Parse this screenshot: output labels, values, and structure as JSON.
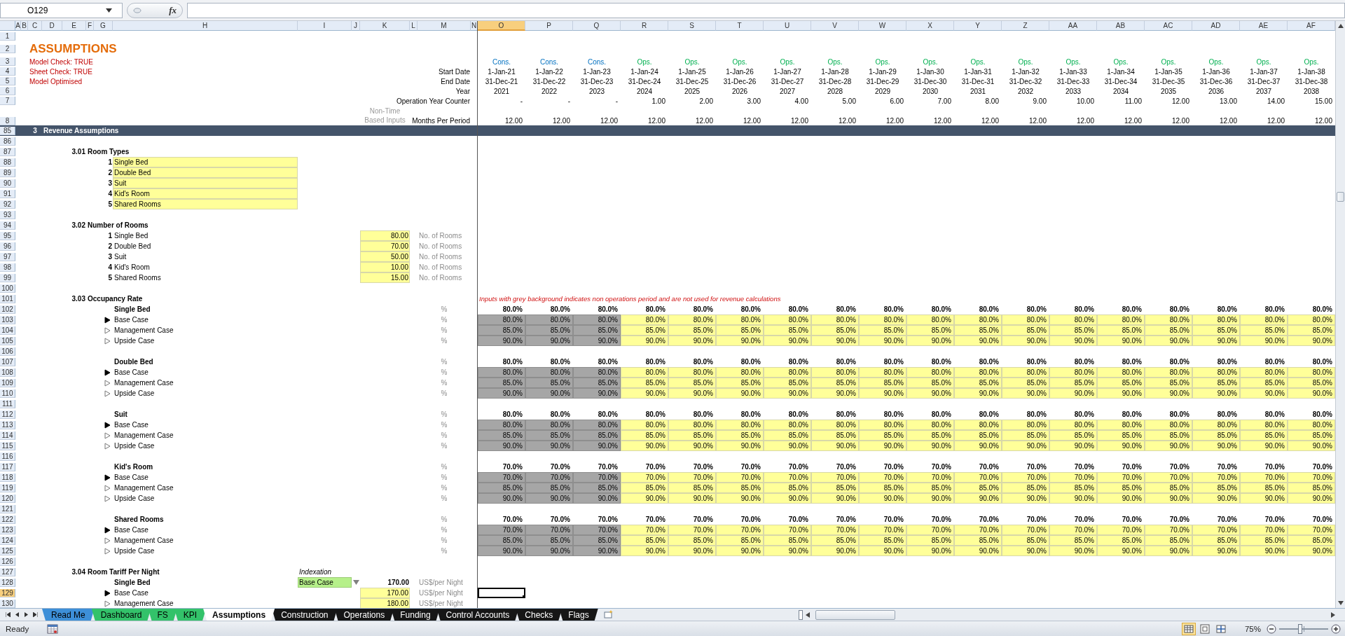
{
  "formula_bar": {
    "name_box": "O129",
    "function_label": "fx"
  },
  "columns": [
    {
      "letter": "A",
      "selected": false
    },
    {
      "letter": "B",
      "selected": false
    },
    {
      "letter": "C",
      "selected": false
    },
    {
      "letter": "D",
      "selected": false
    },
    {
      "letter": "E",
      "selected": false
    },
    {
      "letter": "F",
      "selected": false
    },
    {
      "letter": "G",
      "selected": false
    },
    {
      "letter": "H",
      "selected": false
    },
    {
      "letter": "I",
      "selected": false
    },
    {
      "letter": "J",
      "selected": false
    },
    {
      "letter": "K",
      "selected": false
    },
    {
      "letter": "L",
      "selected": false
    },
    {
      "letter": "M",
      "selected": false
    },
    {
      "letter": "N",
      "selected": false
    },
    {
      "letter": "O",
      "selected": true,
      "kind": "construction"
    },
    {
      "letter": "P",
      "selected": false,
      "kind": "construction"
    },
    {
      "letter": "Q",
      "selected": false,
      "kind": "construction"
    },
    {
      "letter": "R",
      "selected": false,
      "kind": "operations"
    },
    {
      "letter": "S",
      "selected": false,
      "kind": "operations"
    },
    {
      "letter": "T",
      "selected": false,
      "kind": "operations"
    },
    {
      "letter": "U",
      "selected": false,
      "kind": "operations"
    },
    {
      "letter": "V",
      "selected": false,
      "kind": "operations"
    },
    {
      "letter": "W",
      "selected": false,
      "kind": "operations"
    },
    {
      "letter": "X",
      "selected": false,
      "kind": "operations"
    },
    {
      "letter": "Y",
      "selected": false,
      "kind": "operations"
    },
    {
      "letter": "Z",
      "selected": false,
      "kind": "operations"
    },
    {
      "letter": "AA",
      "selected": false,
      "kind": "operations"
    },
    {
      "letter": "AB",
      "selected": false,
      "kind": "operations"
    },
    {
      "letter": "AC",
      "selected": false,
      "kind": "operations"
    },
    {
      "letter": "AD",
      "selected": false,
      "kind": "operations"
    },
    {
      "letter": "AE",
      "selected": false,
      "kind": "operations"
    },
    {
      "letter": "AF",
      "selected": false,
      "kind": "operations"
    }
  ],
  "rows": [
    {
      "number": "1",
      "selected": false,
      "kind": "plain"
    },
    {
      "number": "2",
      "selected": false,
      "kind": "title",
      "cells": {
        "C": {
          "kind": "title",
          "text": "ASSUMPTIONS"
        }
      }
    },
    {
      "number": "3",
      "selected": false,
      "kind": "periods",
      "cells": {
        "C": {
          "kind": "check",
          "text": "Model Check: TRUE"
        }
      },
      "values": [
        "Cons.",
        "Cons.",
        "Cons.",
        "Ops.",
        "Ops.",
        "Ops.",
        "Ops.",
        "Ops.",
        "Ops.",
        "Ops.",
        "Ops.",
        "Ops.",
        "Ops.",
        "Ops.",
        "Ops.",
        "Ops.",
        "Ops.",
        "Ops."
      ]
    },
    {
      "number": "4",
      "selected": false,
      "kind": "dates",
      "cells": {
        "C": {
          "kind": "check",
          "text": "Sheet Check: TRUE"
        },
        "M": {
          "kind": "label",
          "text": "Start Date"
        }
      },
      "values": [
        "1-Jan-21",
        "1-Jan-22",
        "1-Jan-23",
        "1-Jan-24",
        "1-Jan-25",
        "1-Jan-26",
        "1-Jan-27",
        "1-Jan-28",
        "1-Jan-29",
        "1-Jan-30",
        "1-Jan-31",
        "1-Jan-32",
        "1-Jan-33",
        "1-Jan-34",
        "1-Jan-35",
        "1-Jan-36",
        "1-Jan-37",
        "1-Jan-38"
      ]
    },
    {
      "number": "5",
      "selected": false,
      "kind": "dates",
      "cells": {
        "C": {
          "kind": "check",
          "text": "Model Optimised"
        },
        "M": {
          "kind": "label",
          "text": "End Date"
        }
      },
      "values": [
        "31-Dec-21",
        "31-Dec-22",
        "31-Dec-23",
        "31-Dec-24",
        "31-Dec-25",
        "31-Dec-26",
        "31-Dec-27",
        "31-Dec-28",
        "31-Dec-29",
        "31-Dec-30",
        "31-Dec-31",
        "31-Dec-32",
        "31-Dec-33",
        "31-Dec-34",
        "31-Dec-35",
        "31-Dec-36",
        "31-Dec-37",
        "31-Dec-38"
      ]
    },
    {
      "number": "6",
      "selected": false,
      "kind": "dates",
      "cells": {
        "M": {
          "kind": "label",
          "text": "Year"
        }
      },
      "values": [
        "2021",
        "2022",
        "2023",
        "2024",
        "2025",
        "2026",
        "2027",
        "2028",
        "2029",
        "2030",
        "2031",
        "2032",
        "2033",
        "2034",
        "2035",
        "2036",
        "2037",
        "2038"
      ]
    },
    {
      "number": "7",
      "selected": false,
      "kind": "counter",
      "cells": {
        "M": {
          "kind": "label",
          "text": "Operation Year Counter"
        }
      },
      "values": [
        "-",
        "-",
        "-",
        "1.00",
        "2.00",
        "3.00",
        "4.00",
        "5.00",
        "6.00",
        "7.00",
        "8.00",
        "9.00",
        "10.00",
        "11.00",
        "12.00",
        "13.00",
        "14.00",
        "15.00"
      ]
    },
    {
      "number": "8",
      "selected": false,
      "kind": "months",
      "cells": {
        "K": {
          "kind": "note",
          "text": "Non-Time Based Inputs"
        },
        "M": {
          "kind": "label",
          "text": "Months Per Period"
        }
      },
      "values": [
        "12.00",
        "12.00",
        "12.00",
        "12.00",
        "12.00",
        "12.00",
        "12.00",
        "12.00",
        "12.00",
        "12.00",
        "12.00",
        "12.00",
        "12.00",
        "12.00",
        "12.00",
        "12.00",
        "12.00",
        "12.00"
      ]
    },
    {
      "number": "85",
      "selected": false,
      "kind": "band",
      "cells": {
        "C": {
          "kind": "section-number",
          "text": "3"
        },
        "D": {
          "kind": "section",
          "text": "Revenue Assumptions"
        }
      }
    },
    {
      "number": "86",
      "selected": false,
      "kind": "plain"
    },
    {
      "number": "87",
      "selected": false,
      "kind": "plain",
      "cells": {
        "E": {
          "kind": "heading-number",
          "text": "3.01"
        },
        "F": {
          "kind": "heading",
          "text": "Room Types"
        }
      }
    },
    {
      "number": "88",
      "selected": false,
      "kind": "plain",
      "cells": {
        "G": {
          "kind": "item-number",
          "text": "1"
        },
        "H": {
          "kind": "input-text",
          "text": "Single Bed"
        }
      }
    },
    {
      "number": "89",
      "selected": false,
      "kind": "plain",
      "cells": {
        "G": {
          "kind": "item-number",
          "text": "2"
        },
        "H": {
          "kind": "input-text",
          "text": "Double Bed"
        }
      }
    },
    {
      "number": "90",
      "selected": false,
      "kind": "plain",
      "cells": {
        "G": {
          "kind": "item-number",
          "text": "3"
        },
        "H": {
          "kind": "input-text",
          "text": "Suit"
        }
      }
    },
    {
      "number": "91",
      "selected": false,
      "kind": "plain",
      "cells": {
        "G": {
          "kind": "item-number",
          "text": "4"
        },
        "H": {
          "kind": "input-text",
          "text": "Kid's Room"
        }
      }
    },
    {
      "number": "92",
      "selected": false,
      "kind": "plain",
      "cells": {
        "G": {
          "kind": "item-number",
          "text": "5"
        },
        "H": {
          "kind": "input-text",
          "text": "Shared Rooms"
        }
      }
    },
    {
      "number": "93",
      "selected": false,
      "kind": "plain"
    },
    {
      "number": "94",
      "selected": false,
      "kind": "plain",
      "cells": {
        "E": {
          "kind": "heading-number",
          "text": "3.02"
        },
        "F": {
          "kind": "heading",
          "text": "Number of Rooms"
        }
      }
    },
    {
      "number": "95",
      "selected": false,
      "kind": "plain",
      "cells": {
        "G": {
          "kind": "item-number",
          "text": "1"
        },
        "H": {
          "kind": "item",
          "text": "Single Bed"
        },
        "K": {
          "kind": "input-number",
          "text": "80.00"
        },
        "M": {
          "kind": "unit",
          "text": "No. of Rooms"
        }
      }
    },
    {
      "number": "96",
      "selected": false,
      "kind": "plain",
      "cells": {
        "G": {
          "kind": "item-number",
          "text": "2"
        },
        "H": {
          "kind": "item",
          "text": "Double Bed"
        },
        "K": {
          "kind": "input-number",
          "text": "70.00"
        },
        "M": {
          "kind": "unit",
          "text": "No. of Rooms"
        }
      }
    },
    {
      "number": "97",
      "selected": false,
      "kind": "plain",
      "cells": {
        "G": {
          "kind": "item-number",
          "text": "3"
        },
        "H": {
          "kind": "item",
          "text": "Suit"
        },
        "K": {
          "kind": "input-number",
          "text": "50.00"
        },
        "M": {
          "kind": "unit",
          "text": "No. of Rooms"
        }
      }
    },
    {
      "number": "98",
      "selected": false,
      "kind": "plain",
      "cells": {
        "G": {
          "kind": "item-number",
          "text": "4"
        },
        "H": {
          "kind": "item",
          "text": "Kid's Room"
        },
        "K": {
          "kind": "input-number",
          "text": "10.00"
        },
        "M": {
          "kind": "unit",
          "text": "No. of Rooms"
        }
      }
    },
    {
      "number": "99",
      "selected": false,
      "kind": "plain",
      "cells": {
        "G": {
          "kind": "item-number",
          "text": "5"
        },
        "H": {
          "kind": "item",
          "text": "Shared Rooms"
        },
        "K": {
          "kind": "input-number",
          "text": "15.00"
        },
        "M": {
          "kind": "unit",
          "text": "No. of Rooms"
        }
      }
    },
    {
      "number": "100",
      "selected": false,
      "kind": "plain"
    },
    {
      "number": "101",
      "selected": false,
      "kind": "plain",
      "cells": {
        "E": {
          "kind": "heading-number",
          "text": "3.03"
        },
        "F": {
          "kind": "heading",
          "text": "Occupancy Rate"
        }
      },
      "note": "Inputs with grey background indicates non operations period and are not used for revenue calculations"
    },
    {
      "number": "102",
      "selected": false,
      "kind": "totals",
      "cells": {
        "H": {
          "kind": "subheading",
          "text": "Single Bed"
        },
        "M": {
          "kind": "unit-center",
          "text": "%"
        }
      },
      "values": [
        "80.0%",
        "80.0%",
        "80.0%",
        "80.0%",
        "80.0%",
        "80.0%",
        "80.0%",
        "80.0%",
        "80.0%",
        "80.0%",
        "80.0%",
        "80.0%",
        "80.0%",
        "80.0%",
        "80.0%",
        "80.0%",
        "80.0%",
        "80.0%"
      ]
    },
    {
      "number": "103",
      "selected": false,
      "kind": "inputs",
      "cells": {
        "H": {
          "kind": "scenario",
          "text": "Base Case",
          "on": true
        },
        "M": {
          "kind": "unit-center",
          "text": "%"
        }
      },
      "values": [
        "80.0%",
        "80.0%",
        "80.0%",
        "80.0%",
        "80.0%",
        "80.0%",
        "80.0%",
        "80.0%",
        "80.0%",
        "80.0%",
        "80.0%",
        "80.0%",
        "80.0%",
        "80.0%",
        "80.0%",
        "80.0%",
        "80.0%",
        "80.0%"
      ]
    },
    {
      "number": "104",
      "selected": false,
      "kind": "inputs",
      "cells": {
        "H": {
          "kind": "scenario",
          "text": "Management Case",
          "on": false
        },
        "M": {
          "kind": "unit-center",
          "text": "%"
        }
      },
      "values": [
        "85.0%",
        "85.0%",
        "85.0%",
        "85.0%",
        "85.0%",
        "85.0%",
        "85.0%",
        "85.0%",
        "85.0%",
        "85.0%",
        "85.0%",
        "85.0%",
        "85.0%",
        "85.0%",
        "85.0%",
        "85.0%",
        "85.0%",
        "85.0%"
      ]
    },
    {
      "number": "105",
      "selected": false,
      "kind": "inputs",
      "cells": {
        "H": {
          "kind": "scenario",
          "text": "Upside Case",
          "on": false
        },
        "M": {
          "kind": "unit-center",
          "text": "%"
        }
      },
      "values": [
        "90.0%",
        "90.0%",
        "90.0%",
        "90.0%",
        "90.0%",
        "90.0%",
        "90.0%",
        "90.0%",
        "90.0%",
        "90.0%",
        "90.0%",
        "90.0%",
        "90.0%",
        "90.0%",
        "90.0%",
        "90.0%",
        "90.0%",
        "90.0%"
      ]
    },
    {
      "number": "106",
      "selected": false,
      "kind": "plain"
    },
    {
      "number": "107",
      "selected": false,
      "kind": "totals",
      "cells": {
        "H": {
          "kind": "subheading",
          "text": "Double Bed"
        },
        "M": {
          "kind": "unit-center",
          "text": "%"
        }
      },
      "values": [
        "80.0%",
        "80.0%",
        "80.0%",
        "80.0%",
        "80.0%",
        "80.0%",
        "80.0%",
        "80.0%",
        "80.0%",
        "80.0%",
        "80.0%",
        "80.0%",
        "80.0%",
        "80.0%",
        "80.0%",
        "80.0%",
        "80.0%",
        "80.0%"
      ]
    },
    {
      "number": "108",
      "selected": false,
      "kind": "inputs",
      "cells": {
        "H": {
          "kind": "scenario",
          "text": "Base Case",
          "on": true
        },
        "M": {
          "kind": "unit-center",
          "text": "%"
        }
      },
      "values": [
        "80.0%",
        "80.0%",
        "80.0%",
        "80.0%",
        "80.0%",
        "80.0%",
        "80.0%",
        "80.0%",
        "80.0%",
        "80.0%",
        "80.0%",
        "80.0%",
        "80.0%",
        "80.0%",
        "80.0%",
        "80.0%",
        "80.0%",
        "80.0%"
      ]
    },
    {
      "number": "109",
      "selected": false,
      "kind": "inputs",
      "cells": {
        "H": {
          "kind": "scenario",
          "text": "Management Case",
          "on": false
        },
        "M": {
          "kind": "unit-center",
          "text": "%"
        }
      },
      "values": [
        "85.0%",
        "85.0%",
        "85.0%",
        "85.0%",
        "85.0%",
        "85.0%",
        "85.0%",
        "85.0%",
        "85.0%",
        "85.0%",
        "85.0%",
        "85.0%",
        "85.0%",
        "85.0%",
        "85.0%",
        "85.0%",
        "85.0%",
        "85.0%"
      ]
    },
    {
      "number": "110",
      "selected": false,
      "kind": "inputs",
      "cells": {
        "H": {
          "kind": "scenario",
          "text": "Upside Case",
          "on": false
        },
        "M": {
          "kind": "unit-center",
          "text": "%"
        }
      },
      "values": [
        "90.0%",
        "90.0%",
        "90.0%",
        "90.0%",
        "90.0%",
        "90.0%",
        "90.0%",
        "90.0%",
        "90.0%",
        "90.0%",
        "90.0%",
        "90.0%",
        "90.0%",
        "90.0%",
        "90.0%",
        "90.0%",
        "90.0%",
        "90.0%"
      ]
    },
    {
      "number": "111",
      "selected": false,
      "kind": "plain"
    },
    {
      "number": "112",
      "selected": false,
      "kind": "totals",
      "cells": {
        "H": {
          "kind": "subheading",
          "text": "Suit"
        },
        "M": {
          "kind": "unit-center",
          "text": "%"
        }
      },
      "values": [
        "80.0%",
        "80.0%",
        "80.0%",
        "80.0%",
        "80.0%",
        "80.0%",
        "80.0%",
        "80.0%",
        "80.0%",
        "80.0%",
        "80.0%",
        "80.0%",
        "80.0%",
        "80.0%",
        "80.0%",
        "80.0%",
        "80.0%",
        "80.0%"
      ]
    },
    {
      "number": "113",
      "selected": false,
      "kind": "inputs",
      "cells": {
        "H": {
          "kind": "scenario",
          "text": "Base Case",
          "on": true
        },
        "M": {
          "kind": "unit-center",
          "text": "%"
        }
      },
      "values": [
        "80.0%",
        "80.0%",
        "80.0%",
        "80.0%",
        "80.0%",
        "80.0%",
        "80.0%",
        "80.0%",
        "80.0%",
        "80.0%",
        "80.0%",
        "80.0%",
        "80.0%",
        "80.0%",
        "80.0%",
        "80.0%",
        "80.0%",
        "80.0%"
      ]
    },
    {
      "number": "114",
      "selected": false,
      "kind": "inputs",
      "cells": {
        "H": {
          "kind": "scenario",
          "text": "Management Case",
          "on": false
        },
        "M": {
          "kind": "unit-center",
          "text": "%"
        }
      },
      "values": [
        "85.0%",
        "85.0%",
        "85.0%",
        "85.0%",
        "85.0%",
        "85.0%",
        "85.0%",
        "85.0%",
        "85.0%",
        "85.0%",
        "85.0%",
        "85.0%",
        "85.0%",
        "85.0%",
        "85.0%",
        "85.0%",
        "85.0%",
        "85.0%"
      ]
    },
    {
      "number": "115",
      "selected": false,
      "kind": "inputs",
      "cells": {
        "H": {
          "kind": "scenario",
          "text": "Upside Case",
          "on": false
        },
        "M": {
          "kind": "unit-center",
          "text": "%"
        }
      },
      "values": [
        "90.0%",
        "90.0%",
        "90.0%",
        "90.0%",
        "90.0%",
        "90.0%",
        "90.0%",
        "90.0%",
        "90.0%",
        "90.0%",
        "90.0%",
        "90.0%",
        "90.0%",
        "90.0%",
        "90.0%",
        "90.0%",
        "90.0%",
        "90.0%"
      ]
    },
    {
      "number": "116",
      "selected": false,
      "kind": "plain"
    },
    {
      "number": "117",
      "selected": false,
      "kind": "totals",
      "cells": {
        "H": {
          "kind": "subheading",
          "text": "Kid's Room"
        },
        "M": {
          "kind": "unit-center",
          "text": "%"
        }
      },
      "values": [
        "70.0%",
        "70.0%",
        "70.0%",
        "70.0%",
        "70.0%",
        "70.0%",
        "70.0%",
        "70.0%",
        "70.0%",
        "70.0%",
        "70.0%",
        "70.0%",
        "70.0%",
        "70.0%",
        "70.0%",
        "70.0%",
        "70.0%",
        "70.0%"
      ]
    },
    {
      "number": "118",
      "selected": false,
      "kind": "inputs",
      "cells": {
        "H": {
          "kind": "scenario",
          "text": "Base Case",
          "on": true
        },
        "M": {
          "kind": "unit-center",
          "text": "%"
        }
      },
      "values": [
        "70.0%",
        "70.0%",
        "70.0%",
        "70.0%",
        "70.0%",
        "70.0%",
        "70.0%",
        "70.0%",
        "70.0%",
        "70.0%",
        "70.0%",
        "70.0%",
        "70.0%",
        "70.0%",
        "70.0%",
        "70.0%",
        "70.0%",
        "70.0%"
      ]
    },
    {
      "number": "119",
      "selected": false,
      "kind": "inputs",
      "cells": {
        "H": {
          "kind": "scenario",
          "text": "Management Case",
          "on": false
        },
        "M": {
          "kind": "unit-center",
          "text": "%"
        }
      },
      "values": [
        "85.0%",
        "85.0%",
        "85.0%",
        "85.0%",
        "85.0%",
        "85.0%",
        "85.0%",
        "85.0%",
        "85.0%",
        "85.0%",
        "85.0%",
        "85.0%",
        "85.0%",
        "85.0%",
        "85.0%",
        "85.0%",
        "85.0%",
        "85.0%"
      ]
    },
    {
      "number": "120",
      "selected": false,
      "kind": "inputs",
      "cells": {
        "H": {
          "kind": "scenario",
          "text": "Upside Case",
          "on": false
        },
        "M": {
          "kind": "unit-center",
          "text": "%"
        }
      },
      "values": [
        "90.0%",
        "90.0%",
        "90.0%",
        "90.0%",
        "90.0%",
        "90.0%",
        "90.0%",
        "90.0%",
        "90.0%",
        "90.0%",
        "90.0%",
        "90.0%",
        "90.0%",
        "90.0%",
        "90.0%",
        "90.0%",
        "90.0%",
        "90.0%"
      ]
    },
    {
      "number": "121",
      "selected": false,
      "kind": "plain"
    },
    {
      "number": "122",
      "selected": false,
      "kind": "totals",
      "cells": {
        "H": {
          "kind": "subheading",
          "text": "Shared Rooms"
        },
        "M": {
          "kind": "unit-center",
          "text": "%"
        }
      },
      "values": [
        "70.0%",
        "70.0%",
        "70.0%",
        "70.0%",
        "70.0%",
        "70.0%",
        "70.0%",
        "70.0%",
        "70.0%",
        "70.0%",
        "70.0%",
        "70.0%",
        "70.0%",
        "70.0%",
        "70.0%",
        "70.0%",
        "70.0%",
        "70.0%"
      ]
    },
    {
      "number": "123",
      "selected": false,
      "kind": "inputs",
      "cells": {
        "H": {
          "kind": "scenario",
          "text": "Base Case",
          "on": true
        },
        "M": {
          "kind": "unit-center",
          "text": "%"
        }
      },
      "values": [
        "70.0%",
        "70.0%",
        "70.0%",
        "70.0%",
        "70.0%",
        "70.0%",
        "70.0%",
        "70.0%",
        "70.0%",
        "70.0%",
        "70.0%",
        "70.0%",
        "70.0%",
        "70.0%",
        "70.0%",
        "70.0%",
        "70.0%",
        "70.0%"
      ]
    },
    {
      "number": "124",
      "selected": false,
      "kind": "inputs",
      "cells": {
        "H": {
          "kind": "scenario",
          "text": "Management Case",
          "on": false
        },
        "M": {
          "kind": "unit-center",
          "text": "%"
        }
      },
      "values": [
        "85.0%",
        "85.0%",
        "85.0%",
        "85.0%",
        "85.0%",
        "85.0%",
        "85.0%",
        "85.0%",
        "85.0%",
        "85.0%",
        "85.0%",
        "85.0%",
        "85.0%",
        "85.0%",
        "85.0%",
        "85.0%",
        "85.0%",
        "85.0%"
      ]
    },
    {
      "number": "125",
      "selected": false,
      "kind": "inputs",
      "cells": {
        "H": {
          "kind": "scenario",
          "text": "Upside Case",
          "on": false
        },
        "M": {
          "kind": "unit-center",
          "text": "%"
        }
      },
      "values": [
        "90.0%",
        "90.0%",
        "90.0%",
        "90.0%",
        "90.0%",
        "90.0%",
        "90.0%",
        "90.0%",
        "90.0%",
        "90.0%",
        "90.0%",
        "90.0%",
        "90.0%",
        "90.0%",
        "90.0%",
        "90.0%",
        "90.0%",
        "90.0%"
      ]
    },
    {
      "number": "126",
      "selected": false,
      "kind": "plain"
    },
    {
      "number": "127",
      "selected": false,
      "kind": "plain",
      "cells": {
        "E": {
          "kind": "heading-number",
          "text": "3.04"
        },
        "F": {
          "kind": "heading",
          "text": "Room Tariff Per Night"
        },
        "I": {
          "kind": "italic-note",
          "text": "Indexation"
        }
      }
    },
    {
      "number": "128",
      "selected": false,
      "kind": "plain",
      "cells": {
        "H": {
          "kind": "subheading",
          "text": "Single Bed"
        },
        "I": {
          "kind": "dropdown",
          "text": "Base Case"
        },
        "J": {
          "kind": "dropdown-arrow"
        },
        "K": {
          "kind": "bold-number",
          "text": "170.00"
        },
        "M": {
          "kind": "unit",
          "text": "US$/per Night"
        }
      }
    },
    {
      "number": "129",
      "selected": true,
      "kind": "plain",
      "cells": {
        "H": {
          "kind": "scenario",
          "text": "Base Case",
          "on": true
        },
        "K": {
          "kind": "input-number",
          "text": "170.00"
        },
        "M": {
          "kind": "unit",
          "text": "US$/per Night"
        }
      }
    },
    {
      "number": "130",
      "selected": false,
      "kind": "plain",
      "cells": {
        "H": {
          "kind": "scenario",
          "text": "Management Case",
          "on": false
        },
        "K": {
          "kind": "input-number",
          "text": "180.00"
        },
        "M": {
          "kind": "unit",
          "text": "US$/per Night"
        }
      }
    }
  ],
  "sheet_tabs": [
    {
      "label": "Read Me",
      "selected": false,
      "color": "#3d8fd8"
    },
    {
      "label": "Dashboard",
      "selected": false,
      "color": "#33c26a"
    },
    {
      "label": "FS",
      "selected": false,
      "color": "#33c26a"
    },
    {
      "label": "KPI",
      "selected": false,
      "color": "#33c26a"
    },
    {
      "label": "Assumptions",
      "selected": true
    },
    {
      "label": "Construction",
      "selected": false,
      "color": "#161616"
    },
    {
      "label": "Operations",
      "selected": false,
      "color": "#161616"
    },
    {
      "label": "Funding",
      "selected": false,
      "color": "#161616"
    },
    {
      "label": "Control Accounts",
      "selected": false,
      "color": "#161616"
    },
    {
      "label": "Checks",
      "selected": false,
      "color": "#161616"
    },
    {
      "label": "Flags",
      "selected": false,
      "color": "#161616"
    }
  ],
  "status_bar": {
    "text": "Ready",
    "views": [
      {
        "kind": "normal",
        "selected": true
      },
      {
        "kind": "page-layout",
        "selected": false
      },
      {
        "kind": "page-break",
        "selected": false
      }
    ],
    "zoom": "75%",
    "zoom_slider": {
      "level": 0.42
    }
  }
}
